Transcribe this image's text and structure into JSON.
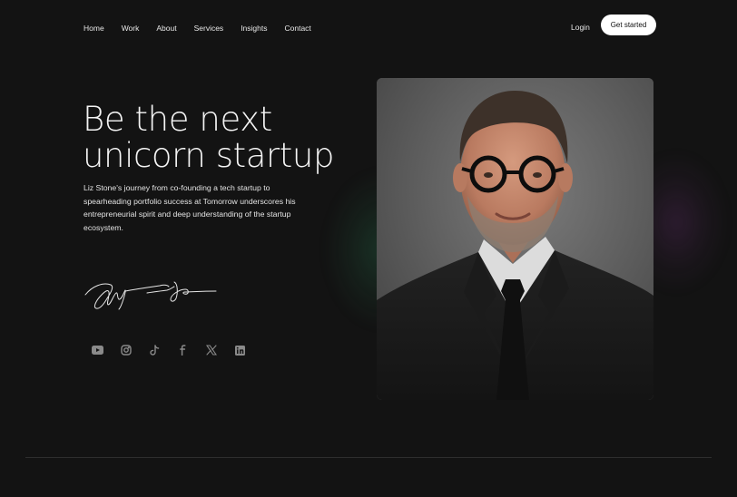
{
  "nav": {
    "items": [
      {
        "label": "Home"
      },
      {
        "label": "Work"
      },
      {
        "label": "About"
      },
      {
        "label": "Services"
      },
      {
        "label": "Insights"
      },
      {
        "label": "Contact"
      }
    ],
    "login_label": "Login",
    "cta_label": "Get started"
  },
  "hero": {
    "headline_line1": "Be the next",
    "headline_line2": "unicorn startup",
    "description": "Liz Stone's journey from co-founding a tech startup to spearheading portfolio success at Tomorrow underscores his entrepreneurial spirit and deep understanding of the startup ecosystem.",
    "signature_icon": "signature",
    "portrait_icon": "portrait-photo"
  },
  "socials": [
    {
      "icon": "youtube-icon"
    },
    {
      "icon": "instagram-icon"
    },
    {
      "icon": "tiktok-icon"
    },
    {
      "icon": "facebook-icon"
    },
    {
      "icon": "x-icon"
    },
    {
      "icon": "linkedin-icon"
    }
  ],
  "colors": {
    "background": "#131313",
    "text": "#f4f4f4",
    "button_bg": "#ffffff",
    "button_text": "#121212",
    "icon": "#8a8a8a",
    "divider": "#2e2e2e"
  }
}
